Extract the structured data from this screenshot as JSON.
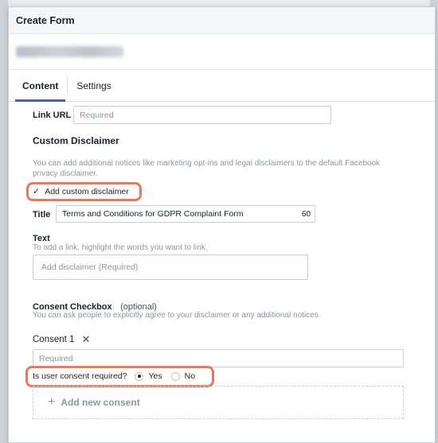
{
  "modal": {
    "title": "Create Form"
  },
  "tabs": [
    {
      "label": "Content",
      "active": true
    },
    {
      "label": "Settings",
      "active": false
    }
  ],
  "link_url": {
    "label": "Link URL",
    "placeholder": "Required"
  },
  "custom_disclaimer": {
    "title": "Custom Disclaimer",
    "description": "You can add additional notices like marketing opt-ins and legal disclaimers to the default Facebook privacy disclaimer.",
    "checkbox_label": "Add custom disclaimer",
    "checked": true,
    "title_field": {
      "label": "Title",
      "value": "Terms and Conditions for GDPR Complaint Form",
      "char_count": "60"
    },
    "text_field": {
      "label": "Text",
      "help": "To add a link, highlight the words you want to link.",
      "placeholder": "Add disclaimer (Required)"
    }
  },
  "consent_checkbox": {
    "title": "Consent Checkbox",
    "optional": "(optional)",
    "description": "You can ask people to explicitly agree to your disclaimer or any additional notices.",
    "consent_1": {
      "label": "Consent 1",
      "placeholder": "Required"
    },
    "required_question": {
      "label": "Is user consent required?",
      "options": [
        {
          "label": "Yes",
          "selected": true
        },
        {
          "label": "No",
          "selected": false
        }
      ]
    },
    "add_new": "Add new consent"
  },
  "colors": {
    "accent": "#4267b2",
    "highlight": "#e8785e"
  }
}
